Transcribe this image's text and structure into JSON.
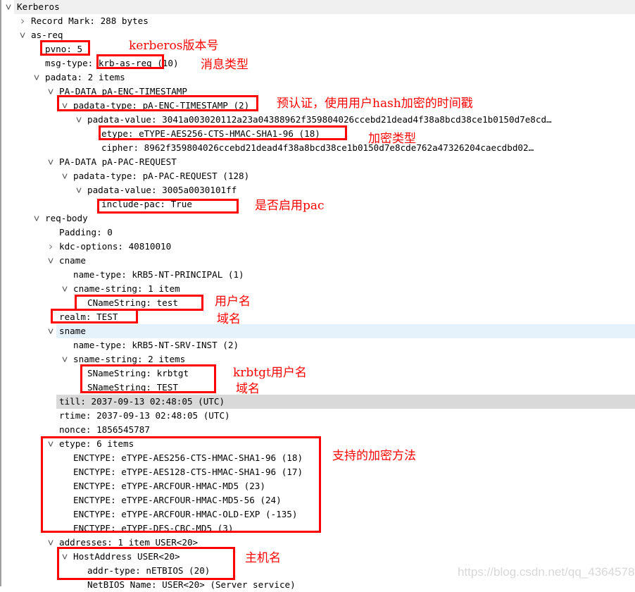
{
  "tree": [
    {
      "level": 0,
      "chevron": "expanded",
      "text": "Kerberos",
      "highlight": "top"
    },
    {
      "level": 1,
      "chevron": "collapsed",
      "text": "Record Mark: 288 bytes"
    },
    {
      "level": 1,
      "chevron": "expanded",
      "text": "as-req"
    },
    {
      "level": 2,
      "chevron": "none",
      "text": "pvno: 5"
    },
    {
      "level": 2,
      "chevron": "none",
      "text": "msg-type: krb-as-req (10)"
    },
    {
      "level": 2,
      "chevron": "expanded",
      "text": "padata: 2 items"
    },
    {
      "level": 3,
      "chevron": "expanded",
      "text": "PA-DATA pA-ENC-TIMESTAMP"
    },
    {
      "level": 4,
      "chevron": "expanded",
      "text": "padata-type: pA-ENC-TIMESTAMP (2)"
    },
    {
      "level": 5,
      "chevron": "expanded",
      "text": "padata-value: 3041a003020112a23a04388962f359804026ccebd21dead4f38a8bcd38ce1b0150d7e8cd…"
    },
    {
      "level": 6,
      "chevron": "none",
      "text": "etype: eTYPE-AES256-CTS-HMAC-SHA1-96 (18)"
    },
    {
      "level": 6,
      "chevron": "none",
      "text": "cipher: 8962f359804026ccebd21dead4f38a8bcd38ce1b0150d7e8cde762a47326204caecdbd02…"
    },
    {
      "level": 3,
      "chevron": "expanded",
      "text": "PA-DATA pA-PAC-REQUEST"
    },
    {
      "level": 4,
      "chevron": "expanded",
      "text": "padata-type: pA-PAC-REQUEST (128)"
    },
    {
      "level": 5,
      "chevron": "expanded",
      "text": "padata-value: 3005a0030101ff"
    },
    {
      "level": 6,
      "chevron": "none",
      "text": "include-pac: True"
    },
    {
      "level": 2,
      "chevron": "expanded",
      "text": "req-body"
    },
    {
      "level": 3,
      "chevron": "none",
      "text": "Padding: 0"
    },
    {
      "level": 3,
      "chevron": "collapsed",
      "text": "kdc-options: 40810010"
    },
    {
      "level": 3,
      "chevron": "expanded",
      "text": "cname"
    },
    {
      "level": 4,
      "chevron": "none",
      "text": "name-type: kRB5-NT-PRINCIPAL (1)"
    },
    {
      "level": 4,
      "chevron": "expanded",
      "text": "cname-string: 1 item"
    },
    {
      "level": 5,
      "chevron": "none",
      "text": "CNameString: test"
    },
    {
      "level": 3,
      "chevron": "none",
      "text": "realm: TEST"
    },
    {
      "level": 3,
      "chevron": "expanded",
      "text": "sname",
      "highlight": "hover"
    },
    {
      "level": 4,
      "chevron": "none",
      "text": "name-type: kRB5-NT-SRV-INST (2)"
    },
    {
      "level": 4,
      "chevron": "expanded",
      "text": "sname-string: 2 items"
    },
    {
      "level": 5,
      "chevron": "none",
      "text": "SNameString: krbtgt"
    },
    {
      "level": 5,
      "chevron": "none",
      "text": "SNameString: TEST"
    },
    {
      "level": 3,
      "chevron": "none",
      "text": "till: 2037-09-13 02:48:05 (UTC)",
      "highlight": "selected"
    },
    {
      "level": 3,
      "chevron": "none",
      "text": "rtime: 2037-09-13 02:48:05 (UTC)"
    },
    {
      "level": 3,
      "chevron": "none",
      "text": "nonce: 1856545787"
    },
    {
      "level": 3,
      "chevron": "expanded",
      "text": "etype: 6 items"
    },
    {
      "level": 4,
      "chevron": "none",
      "text": "ENCTYPE: eTYPE-AES256-CTS-HMAC-SHA1-96 (18)"
    },
    {
      "level": 4,
      "chevron": "none",
      "text": "ENCTYPE: eTYPE-AES128-CTS-HMAC-SHA1-96 (17)"
    },
    {
      "level": 4,
      "chevron": "none",
      "text": "ENCTYPE: eTYPE-ARCFOUR-HMAC-MD5 (23)"
    },
    {
      "level": 4,
      "chevron": "none",
      "text": "ENCTYPE: eTYPE-ARCFOUR-HMAC-MD5-56 (24)"
    },
    {
      "level": 4,
      "chevron": "none",
      "text": "ENCTYPE: eTYPE-ARCFOUR-HMAC-OLD-EXP (-135)"
    },
    {
      "level": 4,
      "chevron": "none",
      "text": "ENCTYPE: eTYPE-DES-CBC-MD5 (3)"
    },
    {
      "level": 3,
      "chevron": "expanded",
      "text": "addresses: 1 item USER<20>"
    },
    {
      "level": 4,
      "chevron": "expanded",
      "text": "HostAddress USER<20>"
    },
    {
      "level": 5,
      "chevron": "none",
      "text": "addr-type: nETBIOS (20)"
    },
    {
      "level": 5,
      "chevron": "none",
      "text": "NetBIOS Name: USER<20> (Server service)"
    }
  ],
  "annotations": {
    "pvno": "kerberos版本号",
    "msg_type": "消息类型",
    "padata_type": "预认证，使用用户hash加密的时间戳",
    "etype": "加密类型",
    "include_pac": "是否启用pac",
    "cname": "用户名",
    "realm": "域名",
    "sname_krbtgt": "krbtgt用户名",
    "sname_realm": "域名",
    "etype_list": "支持的加密方法",
    "host_address": "主机名"
  },
  "watermark": "https://blog.csdn.net/qq_43645782",
  "colors": {
    "annotation": "#ff0000",
    "selected_row": "#d9d9d9",
    "hover_row": "#e5f1fb",
    "top_row": "#f0f0f0"
  },
  "icons": {
    "expanded": "chevron-down-icon",
    "collapsed": "chevron-right-icon"
  }
}
